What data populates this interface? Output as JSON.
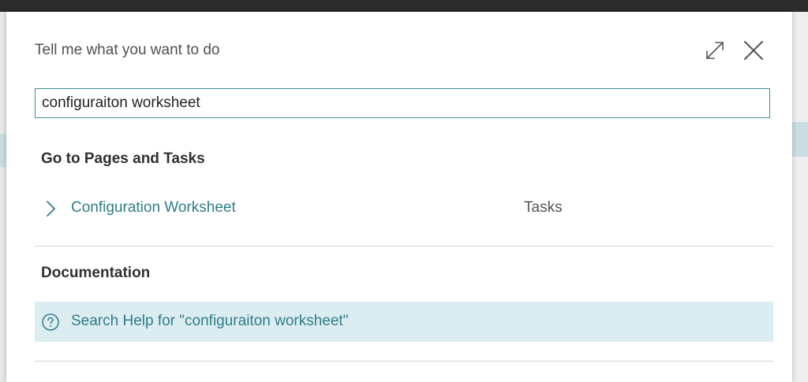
{
  "dialog": {
    "title": "Tell me what you want to do",
    "expand_icon": "expand-icon",
    "close_icon": "close-icon"
  },
  "search": {
    "value": "configuraiton worksheet"
  },
  "pages_section": {
    "heading": "Go to Pages and Tasks",
    "results": [
      {
        "label": "Configuration Worksheet",
        "category": "Tasks",
        "icon": "chevron-right-icon"
      }
    ]
  },
  "documentation_section": {
    "heading": "Documentation",
    "help_link": "Search Help for \"configuraiton worksheet\"",
    "help_icon": "question-circle-icon"
  },
  "colors": {
    "accent": "#2f7d86",
    "search_border": "#3f8f8f",
    "help_row_bg": "#dcedf1",
    "top_bar": "#2b2b2b"
  }
}
